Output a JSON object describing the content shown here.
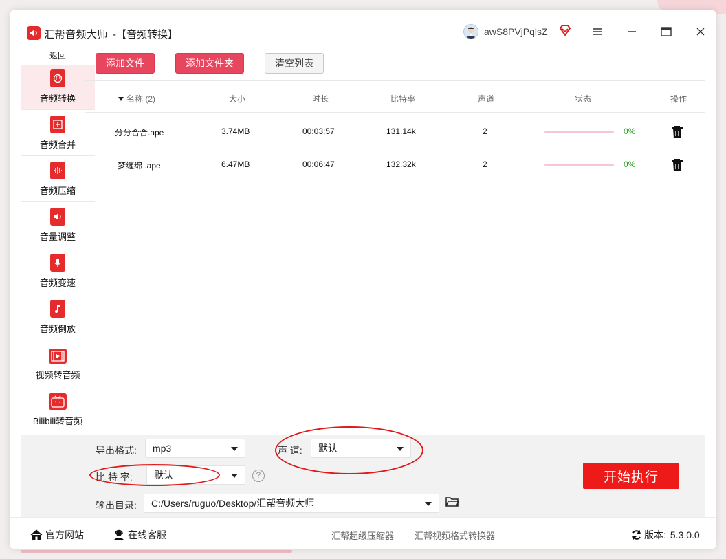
{
  "window": {
    "app_title": "汇帮音频大师",
    "app_subtitle": "-【音频转换】",
    "user_name": "awS8PVjPqlsZ"
  },
  "sidebar": {
    "back_label": "返回",
    "items": [
      {
        "label": "音频转换",
        "icon": "audio-convert-icon",
        "active": true
      },
      {
        "label": "音频合并",
        "icon": "audio-merge-icon",
        "active": false
      },
      {
        "label": "音频压缩",
        "icon": "audio-compress-icon",
        "active": false
      },
      {
        "label": "音量调整",
        "icon": "volume-icon",
        "active": false
      },
      {
        "label": "音频变速",
        "icon": "microphone-icon",
        "active": false
      },
      {
        "label": "音频倒放",
        "icon": "music-note-icon",
        "active": false
      },
      {
        "label": "视频转音频",
        "icon": "film-icon",
        "active": false
      },
      {
        "label": "Bilibili转音频",
        "icon": "tv-icon",
        "active": false
      }
    ]
  },
  "toolbar": {
    "add_file": "添加文件",
    "add_folder": "添加文件夹",
    "clear_list": "清空列表"
  },
  "table": {
    "headers": {
      "name": "名称 (2)",
      "size": "大小",
      "duration": "时长",
      "bitrate": "比特率",
      "channels": "声道",
      "status": "状态",
      "action": "操作"
    },
    "rows": [
      {
        "name": "分分合合.ape",
        "size": "3.74MB",
        "duration": "00:03:57",
        "bitrate": "131.14k",
        "channels": "2",
        "progress": "0%"
      },
      {
        "name": "梦缠绵 .ape",
        "size": "6.47MB",
        "duration": "00:06:47",
        "bitrate": "132.32k",
        "channels": "2",
        "progress": "0%"
      }
    ]
  },
  "settings": {
    "format_label": "导出格式:",
    "format_value": "mp3",
    "channel_label": "声 道:",
    "channel_value": "默认",
    "bitrate_label": "比 特 率:",
    "bitrate_value": "默认",
    "help": "?",
    "output_label": "输出目录:",
    "output_value": "C:/Users/ruguo/Desktop/汇帮音频大师",
    "start_button": "开始执行"
  },
  "footer": {
    "website": "官方网站",
    "support": "在线客服",
    "link1": "汇帮超级压缩器",
    "link2": "汇帮视频格式转换器",
    "version_label": "版本:",
    "version": "5.3.0.0"
  },
  "colors": {
    "accent": "#e8455f",
    "start_button": "#ee1a1a",
    "progress_text": "#2ba02b",
    "sidebar_active_bg": "#fbe9eb",
    "annotation": "#e01a1a"
  }
}
